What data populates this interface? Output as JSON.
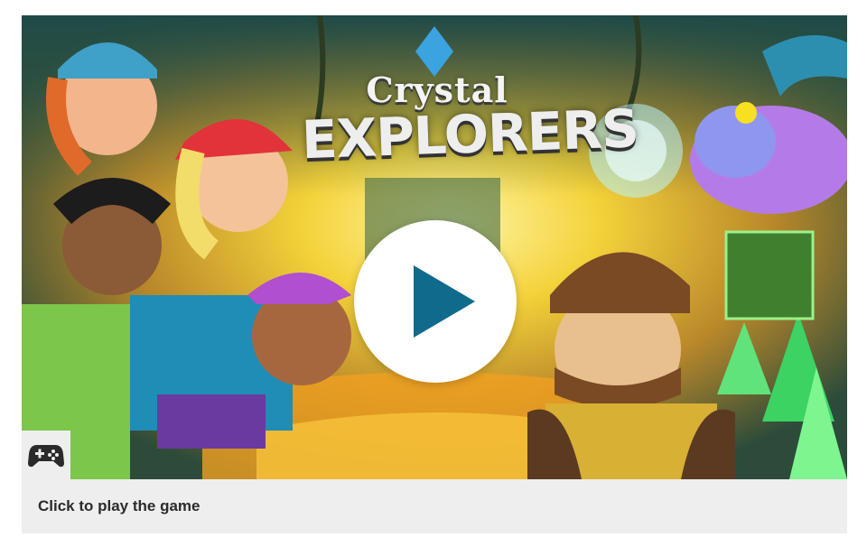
{
  "game": {
    "title_line1": "Crystal",
    "title_line2": "EXPLORERS",
    "caption": "Click to play the game",
    "play_icon": "play-icon",
    "badge_icon": "gamepad-icon"
  },
  "colors": {
    "play_accent": "#0f6a8c",
    "caption_bg": "#eeeeee",
    "caption_text": "#2b2b2b"
  }
}
